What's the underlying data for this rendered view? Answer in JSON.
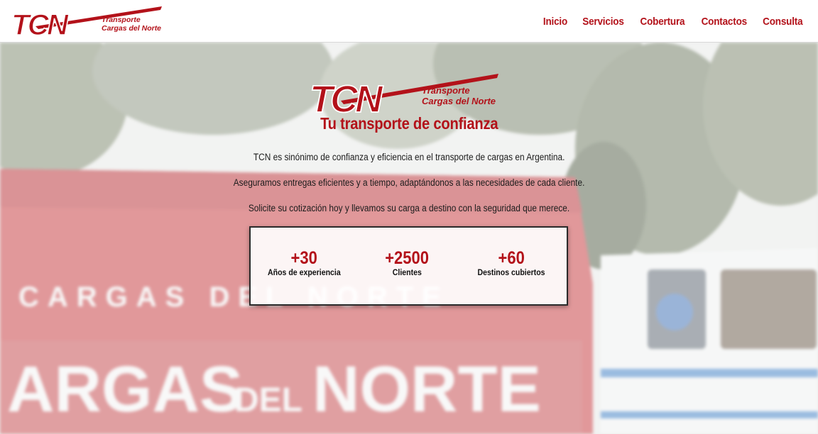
{
  "brand": {
    "logo_text": "TCN",
    "logo_line1": "Transporte",
    "logo_line2": "Cargas del Norte"
  },
  "nav": {
    "items": [
      "Inicio",
      "Servicios",
      "Cobertura",
      "Contactos",
      "Consulta"
    ]
  },
  "hero": {
    "tagline": "Tu transporte de confianza",
    "paragraphs": [
      "TCN es sinónimo de confianza y eficiencia en el transporte de cargas en Argentina.",
      "Aseguramos entregas eficientes y a tiempo, adaptándonos a las necesidades de cada cliente.",
      "Solicite su cotización hoy y llevamos su carga a destino con la seguridad que merece."
    ],
    "background_text": [
      "CARGAS DEL NORTE",
      "ARGAS",
      "DEL",
      "NORTE"
    ]
  },
  "stats": [
    {
      "value": "+30",
      "label": "Años de experiencia"
    },
    {
      "value": "+2500",
      "label": "Clientes"
    },
    {
      "value": "+60",
      "label": "Destinos cubiertos"
    }
  ],
  "colors": {
    "brand_red": "#b3121a",
    "text_dark": "#1c1c1c"
  }
}
